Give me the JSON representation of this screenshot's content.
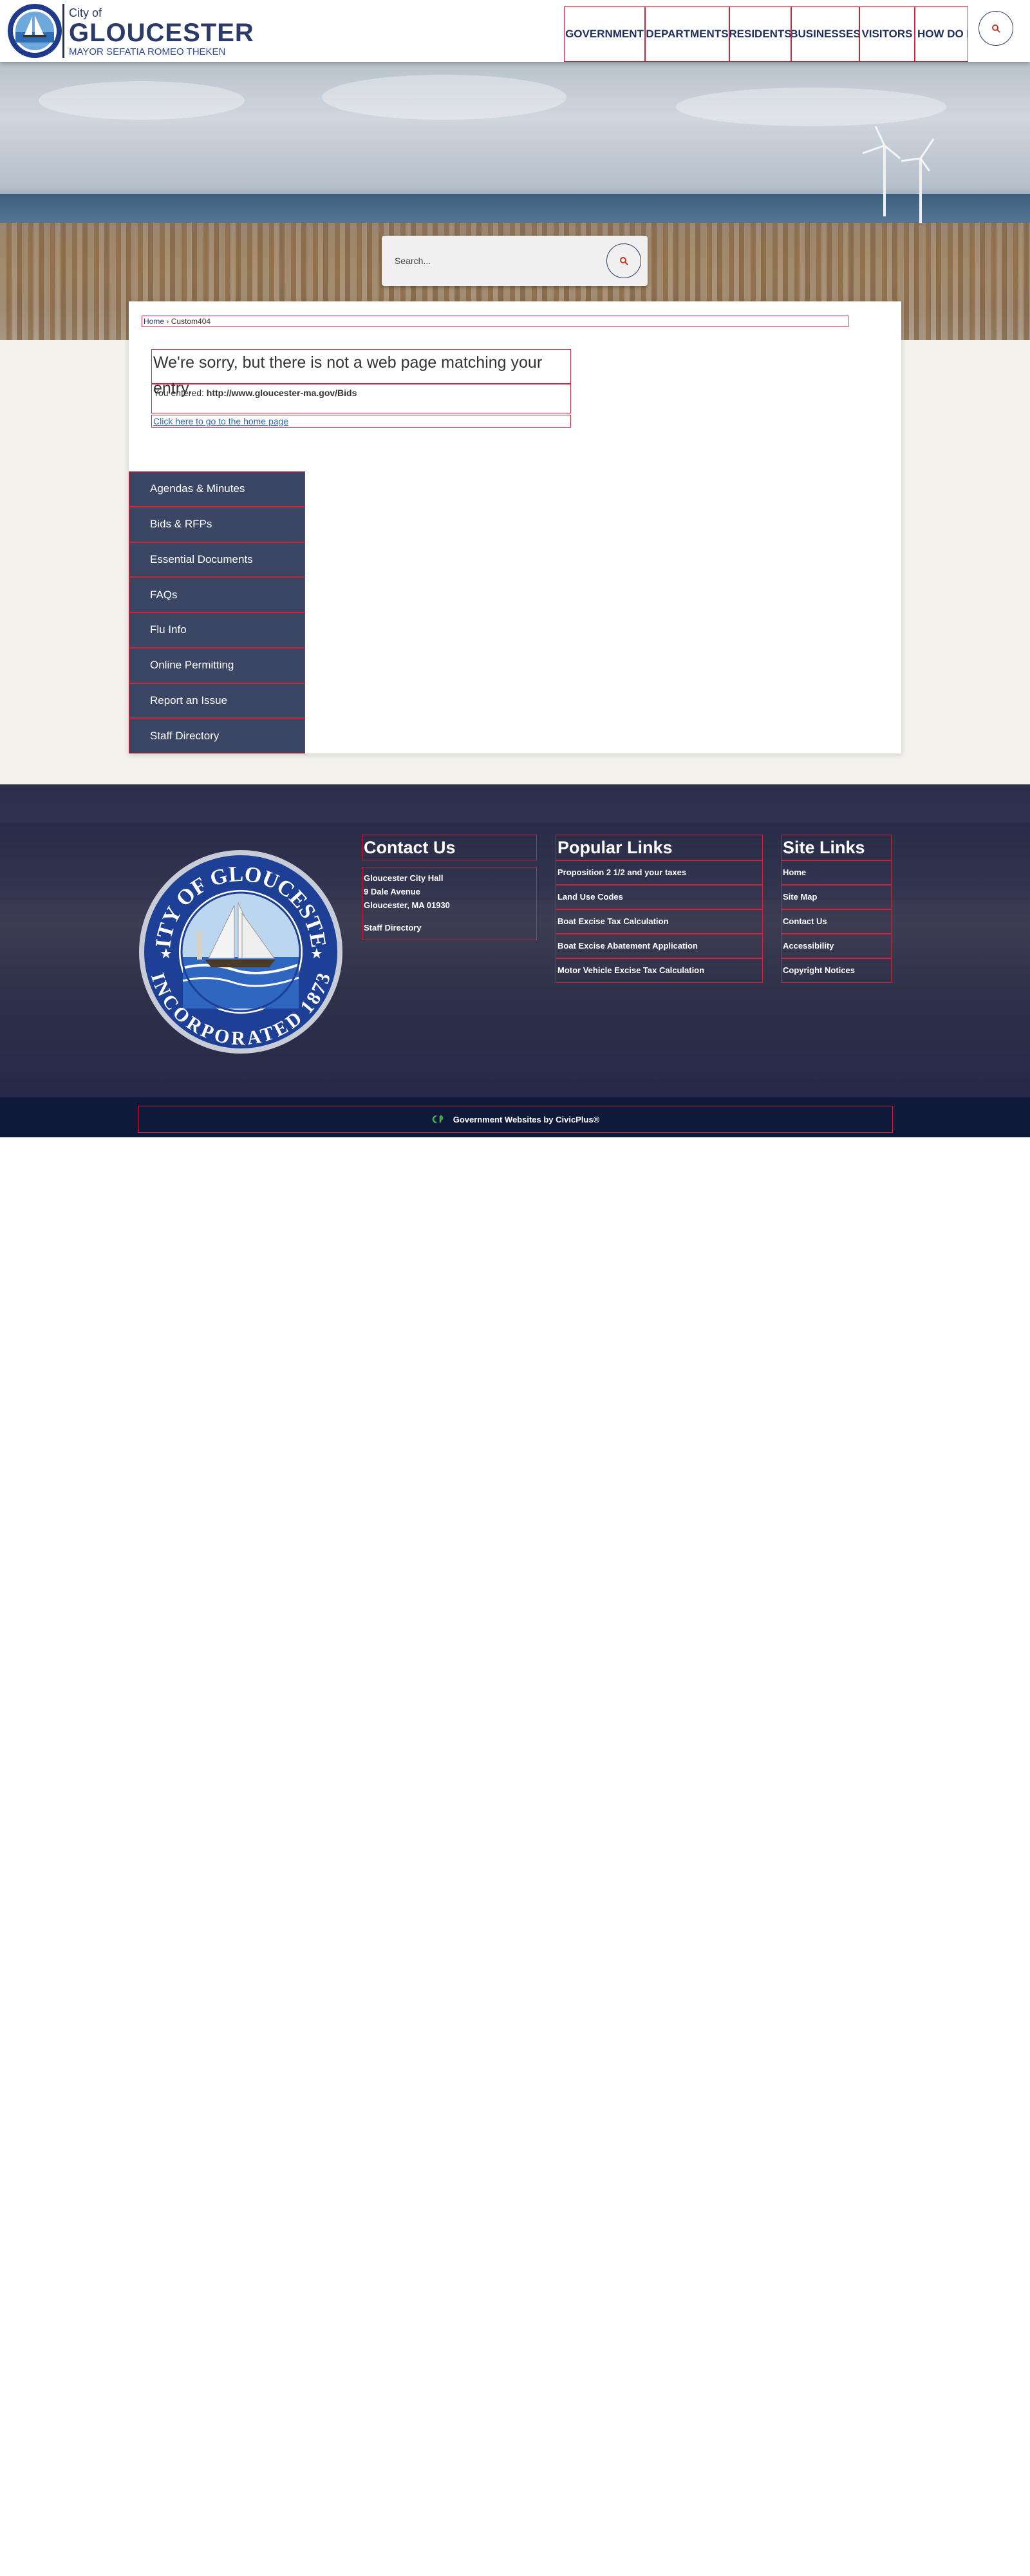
{
  "header": {
    "city_of": "City of",
    "city_name": "GLOUCESTER",
    "mayor": "MAYOR SEFATIA ROMEO THEKEN",
    "nav": [
      "GOVERNMENT",
      "DEPARTMENTS",
      "RESIDENTS",
      "BUSINESSES",
      "VISITORS",
      "HOW DO I"
    ],
    "search_icon": "search-icon"
  },
  "hero": {
    "search_placeholder": "Search..."
  },
  "breadcrumb": {
    "home": "Home",
    "separator": " › ",
    "current": "Custom404"
  },
  "error": {
    "title": "We're sorry, but there is not a web page matching your entry.",
    "entered_label": "You entered: ",
    "entered_url": "http://www.gloucester-ma.gov/Bids",
    "home_link": "Click here to go to the home page"
  },
  "sidebar": {
    "items": [
      "Agendas & Minutes",
      "Bids & RFPs",
      "Essential Documents",
      "FAQs",
      "Flu Info",
      "Online Permitting",
      "Report an Issue",
      "Staff Directory"
    ]
  },
  "footer": {
    "seal": {
      "top_text": "CITY OF GLOUCESTER",
      "bottom_text": "INCORPORATED 1873"
    },
    "contact": {
      "title": "Contact Us",
      "line1": "Gloucester City Hall",
      "line2": "9 Dale Avenue",
      "line3": "Gloucester, MA 01930",
      "staff": "Staff Directory"
    },
    "popular": {
      "title": "Popular Links",
      "links": [
        "Proposition 2 1/2 and your taxes",
        "Land Use Codes",
        "Boat Excise Tax Calculation",
        "Boat Excise Abatement Application",
        "Motor Vehicle Excise Tax Calculation"
      ]
    },
    "site": {
      "title": "Site Links",
      "links": [
        "Home",
        "Site Map",
        "Contact Us",
        "Accessibility",
        "Copyright Notices"
      ]
    },
    "civic": "Government Websites by CivicPlus®"
  },
  "colors": {
    "navy": "#2b3a67",
    "sidebar_bg": "#3a4663",
    "outline_red": "#d0223a",
    "search_icon_red": "#c0392b",
    "civic_green": "#4caf50"
  }
}
